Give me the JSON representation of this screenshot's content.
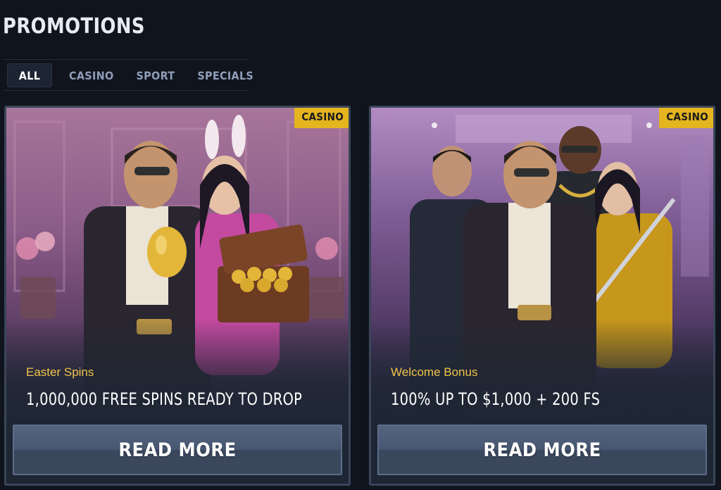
{
  "page": {
    "title": "PROMOTIONS"
  },
  "tabs": [
    {
      "label": "ALL",
      "active": true
    },
    {
      "label": "CASINO",
      "active": false
    },
    {
      "label": "SPORT",
      "active": false
    },
    {
      "label": "SPECIALS",
      "active": false
    }
  ],
  "promotions": [
    {
      "badge": "CASINO",
      "subtitle": "Easter Spins",
      "headline": "1,000,000 FREE SPINS READY TO DROP",
      "button": "READ MORE"
    },
    {
      "badge": "CASINO",
      "subtitle": "Welcome Bonus",
      "headline": "100% UP TO $1,000 + 200 FS",
      "button": "READ MORE"
    }
  ],
  "colors": {
    "background": "#10141d",
    "badge": "#e4b51f",
    "subtitle": "#f0c44a",
    "button": "#475671"
  }
}
